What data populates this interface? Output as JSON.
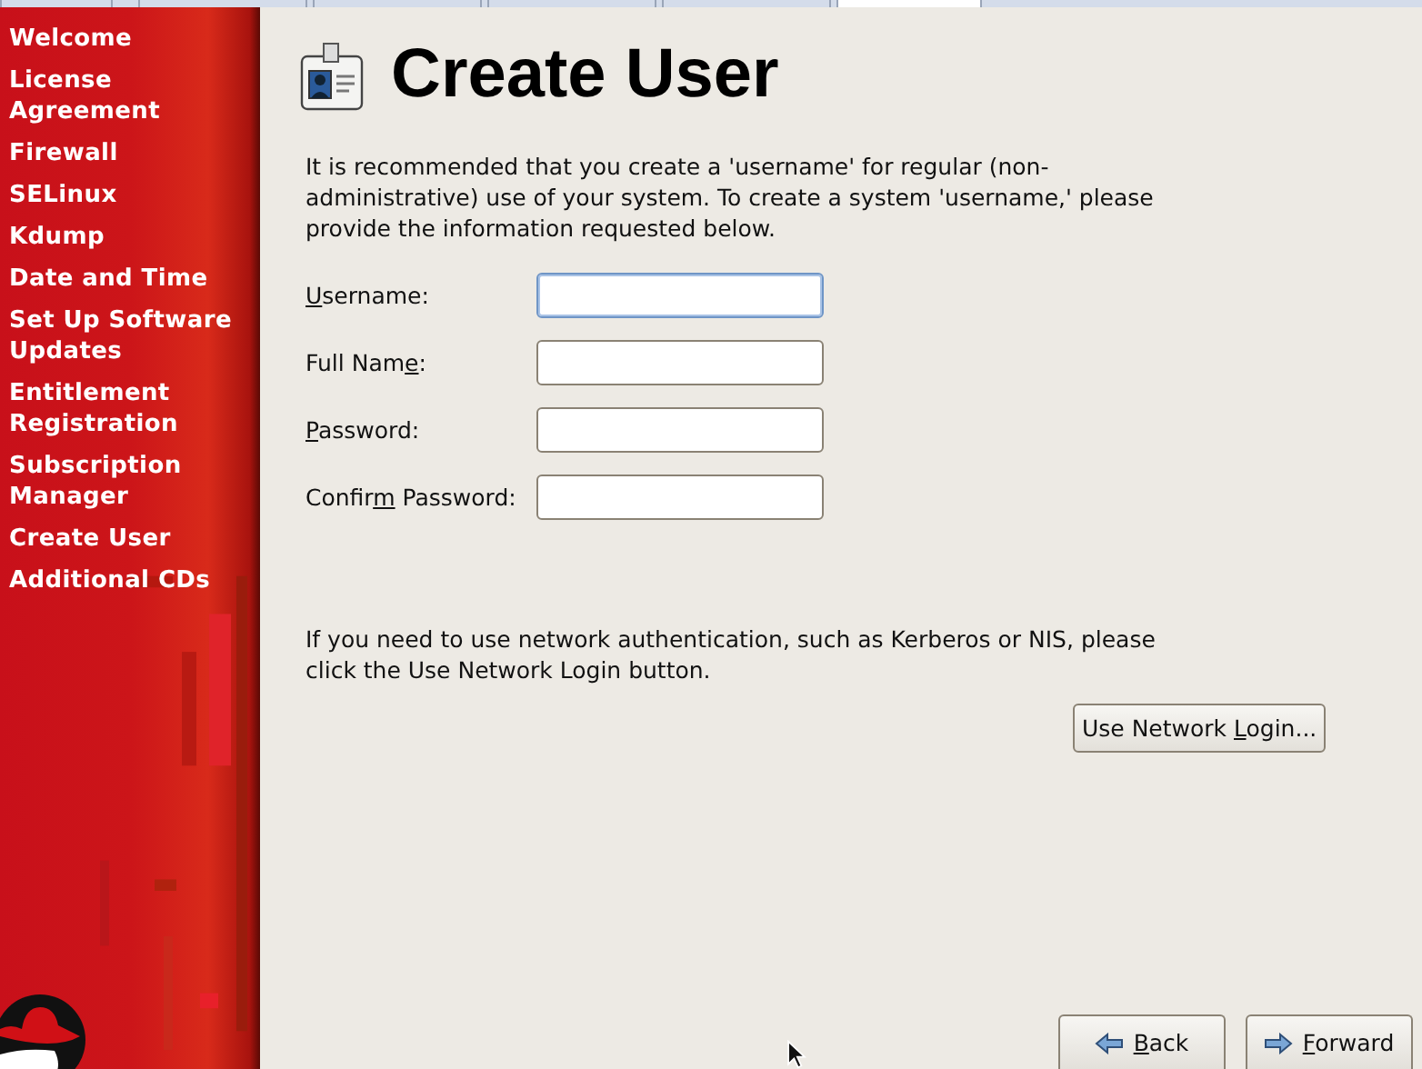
{
  "top_tabs": [
    {
      "selected": false
    },
    {
      "selected": false
    },
    {
      "selected": false
    },
    {
      "selected": false
    },
    {
      "selected": false
    },
    {
      "selected": true
    }
  ],
  "sidebar": {
    "items": [
      {
        "label": "Welcome",
        "selected": false
      },
      {
        "label": "License Agreement",
        "selected": false
      },
      {
        "label": "Firewall",
        "selected": false
      },
      {
        "label": "SELinux",
        "selected": false
      },
      {
        "label": "Kdump",
        "selected": false
      },
      {
        "label": "Date and Time",
        "selected": false
      },
      {
        "label": "Set Up Software Updates",
        "selected": false
      },
      {
        "label": "Entitlement Registration",
        "selected": false
      },
      {
        "label": "Subscription Manager",
        "selected": false
      },
      {
        "label": "Create User",
        "selected": false
      },
      {
        "label": "Additional CDs",
        "selected": false
      }
    ]
  },
  "page": {
    "title": "Create User",
    "intro": "It is recommended that you create a 'username' for regular (non-administrative) use of your system. To create a system 'username,' please provide the information requested below.",
    "fields": [
      {
        "access_key": "U",
        "label_after": "sername:",
        "focused": true
      },
      {
        "label_before": "Full Nam",
        "access_key": "e",
        "label_after": ":",
        "focused": false
      },
      {
        "access_key": "P",
        "label_after": "assword:",
        "focused": false
      },
      {
        "label_before": "Confir",
        "access_key": "m",
        "label_after": " Password:",
        "focused": false
      }
    ],
    "network_note": "If you need to use network authentication, such as Kerberos or NIS, please click the Use Network Login button.",
    "network_button": {
      "label_before": "Use Network ",
      "access_key": "L",
      "label_after": "ogin..."
    }
  },
  "nav_buttons": [
    {
      "kind": "back",
      "access_key": "B",
      "label_after": "ack"
    },
    {
      "kind": "forward",
      "access_key": "F",
      "label_after": "orward"
    }
  ]
}
